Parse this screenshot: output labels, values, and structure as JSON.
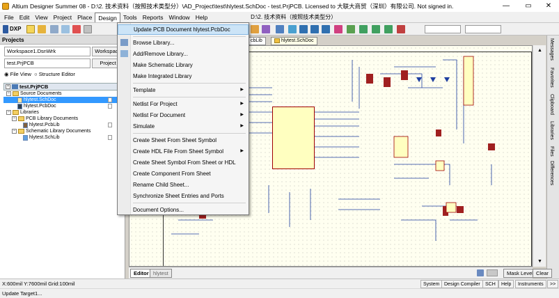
{
  "window": {
    "title": "Altium Designer Summer 08 - D:\\2. 技术资料（按照技术类型分）\\AD_Project\\test\\hlytest.SchDoc - test.PrjPCB. Licensed to 大联大商贸（深圳）有限公司. Not signed in.",
    "minimize": "—",
    "maximize": "▭",
    "close": "✕"
  },
  "menubar": {
    "items": [
      "File",
      "Edit",
      "View",
      "Project",
      "Place",
      "Design",
      "Tools",
      "Reports",
      "Window",
      "Help"
    ],
    "path": "D:\\2. 技术资料（按照技术类型分）"
  },
  "toolbar": {
    "dxp_label": "DXP"
  },
  "projects_panel": {
    "title": "Projects",
    "workspace_value": "Workspace1.DsnWrk",
    "workspace_button": "Workspace",
    "project_value": "test.PrjPCB",
    "project_button": "Project",
    "view_file": "File View",
    "view_structure": "Structure Editor",
    "tree": {
      "root": "test.PrjPCB",
      "source_documents": "Source Documents",
      "schdoc": "hlytest.SchDoc",
      "pcbdoc": "hlytest.PcbDoc",
      "libraries": "Libraries",
      "pcb_lib_docs": "PCB Library Documents",
      "pcblib": "hlytest.PcbLib",
      "sch_lib_docs": "Schematic Library Documents",
      "schlib": "hlytest.SchLib"
    }
  },
  "doc_tabs": [
    "cbLib",
    "hlytest.SchDoc"
  ],
  "design_menu": {
    "items": [
      {
        "label": "Update PCB Document hlytest.PcbDoc",
        "submenu": false,
        "highlighted": true
      },
      {
        "label": "Browse Library...",
        "submenu": false
      },
      {
        "label": "Add/Remove Library...",
        "submenu": false
      },
      {
        "label": "Make Schematic Library",
        "submenu": false
      },
      {
        "label": "Make Integrated Library",
        "submenu": false
      },
      {
        "label": "Template",
        "submenu": true
      },
      {
        "label": "Netlist For Project",
        "submenu": true
      },
      {
        "label": "Netlist For Document",
        "submenu": true
      },
      {
        "label": "Simulate",
        "submenu": true
      },
      {
        "label": "Create Sheet From Sheet Symbol",
        "submenu": false
      },
      {
        "label": "Create HDL File From Sheet Symbol",
        "submenu": true
      },
      {
        "label": "Create Sheet Symbol From Sheet or HDL",
        "submenu": false
      },
      {
        "label": "Create Component From Sheet",
        "submenu": false
      },
      {
        "label": "Rename Child Sheet...",
        "submenu": false
      },
      {
        "label": "Synchronize Sheet Entries and Ports",
        "submenu": false
      },
      {
        "label": "Document Options...",
        "submenu": false
      }
    ],
    "arrow": "▶"
  },
  "bottom_tabs": {
    "editor": "Editor",
    "hlytest": "hlytest",
    "mask_level": "Mask Level",
    "clear": "Clear"
  },
  "right_panel_tabs": [
    "Messages",
    "Favorites",
    "Clipboard",
    "Libraries",
    "Files",
    "Differences"
  ],
  "statusbar": {
    "coords": "X:600mil Y:7600mil   Grid:100mil",
    "buttons": [
      "System",
      "Design Compiler",
      "SCH",
      "Help",
      "Instruments"
    ],
    "more": ">>",
    "message": "Update Target1..."
  }
}
